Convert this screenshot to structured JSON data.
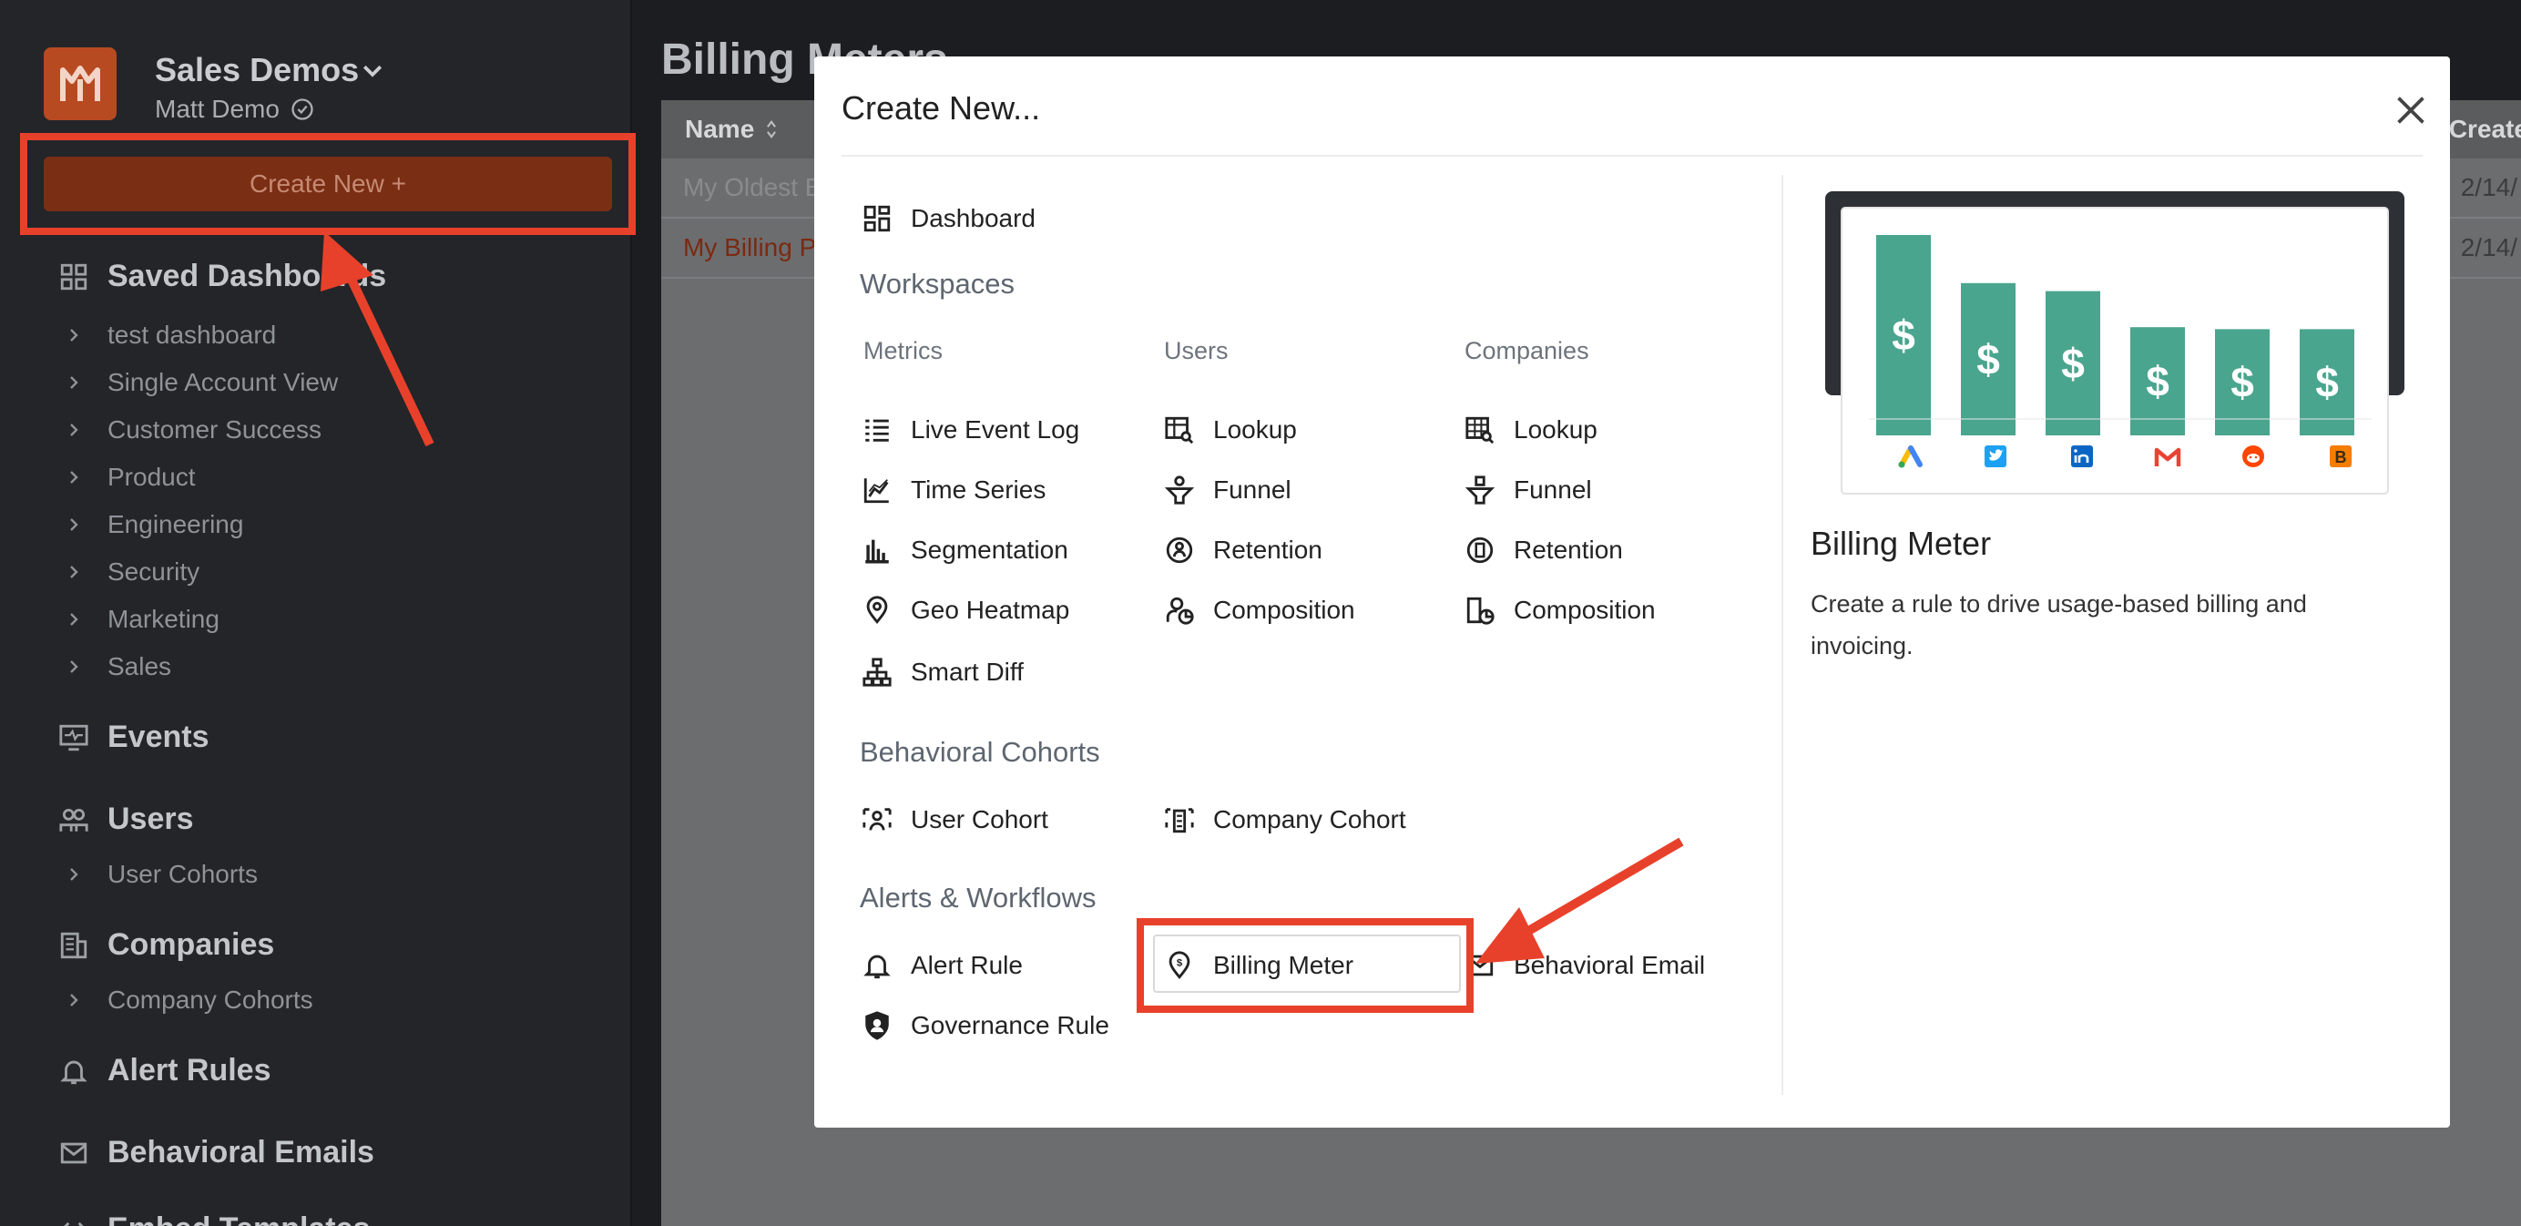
{
  "sidebar": {
    "org_name": "Sales Demos",
    "user_name": "Matt Demo",
    "create_button": "Create New +",
    "saved_dashboards": {
      "label": "Saved Dashboards",
      "items": [
        "test dashboard",
        "Single Account View",
        "Customer Success",
        "Product",
        "Engineering",
        "Security",
        "Marketing",
        "Sales"
      ]
    },
    "events_label": "Events",
    "users": {
      "label": "Users",
      "items": [
        "User Cohorts"
      ]
    },
    "companies": {
      "label": "Companies",
      "items": [
        "Company Cohorts"
      ]
    },
    "alert_rules_label": "Alert Rules",
    "behavioral_emails_label": "Behavioral Emails",
    "cut_off_label": "Embed Templates"
  },
  "main": {
    "title": "Billing Meters",
    "columns": {
      "name": "Name",
      "created": "Create"
    },
    "rows": [
      {
        "name": "My Oldest B",
        "date": "2/14/"
      },
      {
        "name": "My Billing P",
        "date": "2/14/"
      }
    ]
  },
  "modal": {
    "title": "Create New...",
    "dashboard_label": "Dashboard",
    "workspaces_title": "Workspaces",
    "metrics": {
      "title": "Metrics",
      "items": [
        "Live Event Log",
        "Time Series",
        "Segmentation",
        "Geo Heatmap",
        "Smart Diff"
      ]
    },
    "users": {
      "title": "Users",
      "items": [
        "Lookup",
        "Funnel",
        "Retention",
        "Composition"
      ]
    },
    "companies": {
      "title": "Companies",
      "items": [
        "Lookup",
        "Funnel",
        "Retention",
        "Composition"
      ]
    },
    "cohorts_title": "Behavioral Cohorts",
    "cohorts": [
      "User Cohort",
      "Company Cohort"
    ],
    "alerts_title": "Alerts & Workflows",
    "alerts": [
      "Alert Rule",
      "Billing Meter",
      "Behavioral Email",
      "Governance Rule"
    ],
    "preview": {
      "title": "Billing Meter",
      "description": "Create a rule to drive usage-based billing and invoicing.",
      "bar_levels": [
        1.0,
        0.76,
        0.72,
        0.54,
        0.53,
        0.53
      ],
      "bar_color": "#4aa58e"
    }
  },
  "colors": {
    "accent": "#e8412b",
    "brand": "#b84a22"
  }
}
